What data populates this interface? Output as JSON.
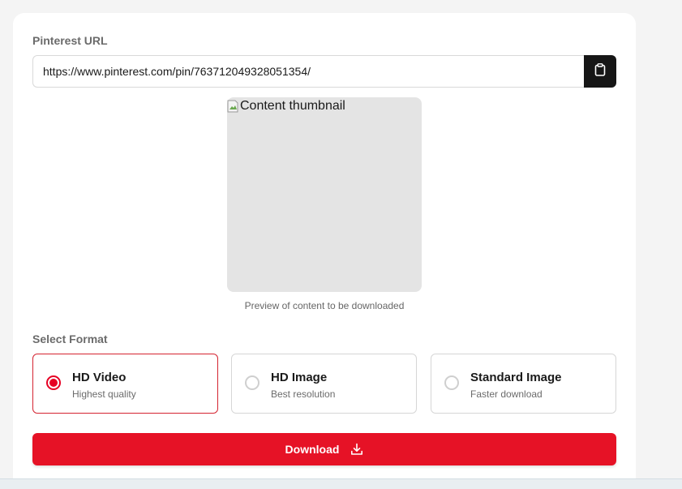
{
  "form": {
    "url_label": "Pinterest URL",
    "url_value": "https://www.pinterest.com/pin/763712049328051354/",
    "paste_icon": "clipboard-icon"
  },
  "preview": {
    "alt_text": "Content thumbnail",
    "caption": "Preview of content to be downloaded"
  },
  "format": {
    "label": "Select Format",
    "options": [
      {
        "title": "HD Video",
        "subtitle": "Highest quality",
        "selected": true
      },
      {
        "title": "HD Image",
        "subtitle": "Best resolution",
        "selected": false
      },
      {
        "title": "Standard Image",
        "subtitle": "Faster download",
        "selected": false
      }
    ]
  },
  "download": {
    "label": "Download",
    "icon": "download-icon"
  },
  "colors": {
    "accent": "#e60023",
    "button": "#e61226",
    "paste_button": "#161616"
  }
}
